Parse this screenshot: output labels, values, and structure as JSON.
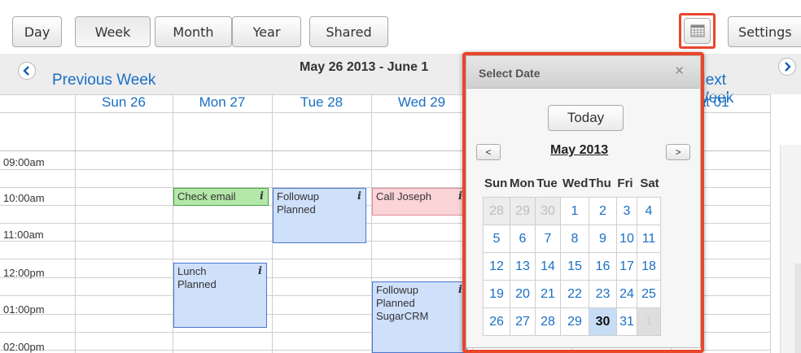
{
  "toolbar": {
    "views": [
      {
        "label": "Day",
        "active": false
      },
      {
        "label": "Week",
        "active": true
      },
      {
        "label": "Month",
        "active": false
      },
      {
        "label": "Year",
        "active": false
      },
      {
        "label": "Shared",
        "active": false
      }
    ],
    "calendar_icon": "calendar-icon",
    "settings_label": "Settings"
  },
  "nav": {
    "prev_label": "Previous Week",
    "next_label": "Next Week",
    "range_title": "May 26 2013 - June 1"
  },
  "week": {
    "days": [
      "Sun 26",
      "Mon 27",
      "Tue 28",
      "Wed 29",
      "",
      "",
      "Sat 01"
    ],
    "times": [
      "09:00am",
      "10:00am",
      "11:00am",
      "12:00pm",
      "01:00pm",
      "02:00pm"
    ],
    "events": [
      {
        "title": "Check email",
        "info": "i",
        "color": "green"
      },
      {
        "title": "Followup Planned",
        "info": "i",
        "color": "blue"
      },
      {
        "title": "Call Joseph",
        "info": "i",
        "color": "red"
      },
      {
        "title": "Lunch Planned",
        "info": "i",
        "color": "blue"
      },
      {
        "title": "Followup Planned SugarCRM",
        "info": "i",
        "color": "blue"
      }
    ]
  },
  "date_picker": {
    "title": "Select Date",
    "close": "×",
    "today_label": "Today",
    "prev_month": "<",
    "next_month": ">",
    "month_label": "May 2013",
    "weekdays": [
      "Sun",
      "Mon",
      "Tue",
      "Wed",
      "Thu",
      "Fri",
      "Sat"
    ],
    "days": [
      "28",
      "29",
      "30",
      "1",
      "2",
      "3",
      "4",
      "5",
      "6",
      "7",
      "8",
      "9",
      "10",
      "11",
      "12",
      "13",
      "14",
      "15",
      "16",
      "17",
      "18",
      "19",
      "20",
      "21",
      "22",
      "23",
      "24",
      "25",
      "26",
      "27",
      "28",
      "29",
      "30",
      "31",
      "1"
    ],
    "selected_day": "30"
  },
  "colors": {
    "accent": "#e9462a",
    "link": "#1a6fc4",
    "event_blue": "#cfe0fb",
    "event_green": "#b4e8a8",
    "event_red": "#fbd4d7"
  }
}
